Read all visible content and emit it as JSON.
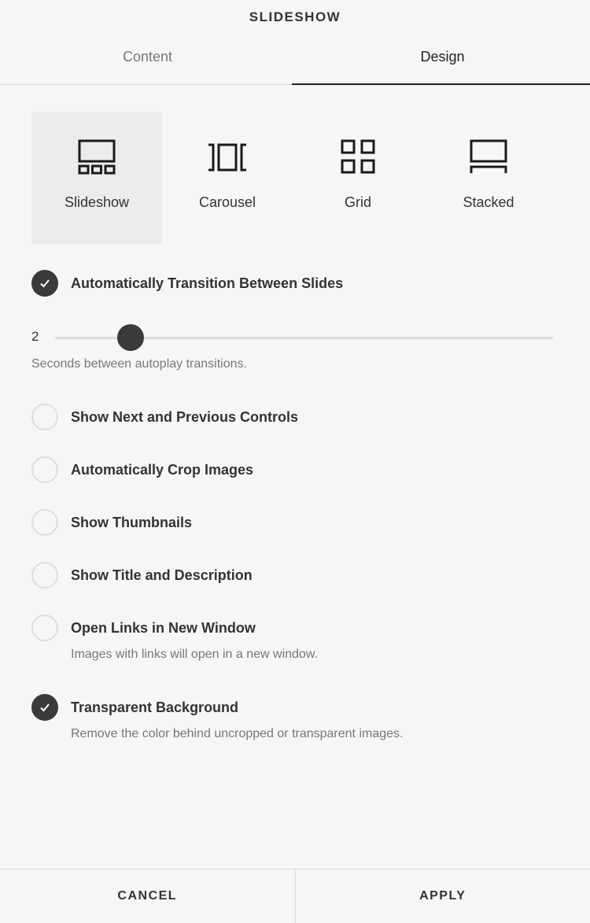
{
  "header": {
    "title": "SLIDESHOW"
  },
  "tabs": [
    {
      "label": "Content",
      "active": false
    },
    {
      "label": "Design",
      "active": true
    }
  ],
  "layouts": [
    {
      "label": "Slideshow",
      "icon": "slideshow-layout-icon",
      "selected": true
    },
    {
      "label": "Carousel",
      "icon": "carousel-layout-icon",
      "selected": false
    },
    {
      "label": "Grid",
      "icon": "grid-layout-icon",
      "selected": false
    },
    {
      "label": "Stacked",
      "icon": "stacked-layout-icon",
      "selected": false
    }
  ],
  "autoplay": {
    "label": "Automatically Transition Between Slides",
    "checked": true,
    "slider_value": "2",
    "helper": "Seconds between autoplay transitions."
  },
  "options": [
    {
      "label": "Show Next and Previous Controls",
      "checked": false
    },
    {
      "label": "Automatically Crop Images",
      "checked": false
    },
    {
      "label": "Show Thumbnails",
      "checked": false
    },
    {
      "label": "Show Title and Description",
      "checked": false
    },
    {
      "label": "Open Links in New Window",
      "checked": false,
      "helper": "Images with links will open in a new window."
    },
    {
      "label": "Transparent Background",
      "checked": true,
      "helper": "Remove the color behind uncropped or transparent images."
    }
  ],
  "footer": {
    "cancel_label": "CANCEL",
    "apply_label": "APPLY"
  },
  "colors": {
    "accent": "#3a3a3a",
    "background": "#f6f6f6",
    "selected_tile": "#ececec"
  }
}
